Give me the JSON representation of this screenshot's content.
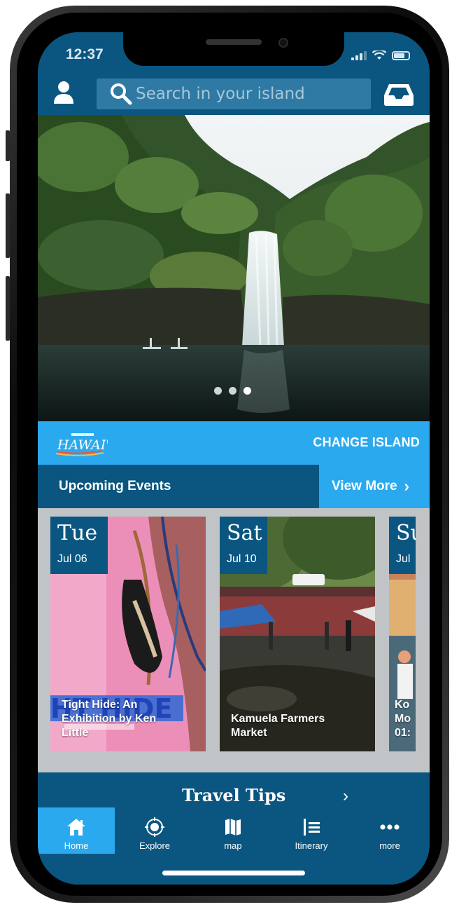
{
  "status": {
    "time": "12:37"
  },
  "header": {
    "search_placeholder": "Search in your island"
  },
  "hero": {
    "carousel_pages": 3,
    "active_page": 3
  },
  "island": {
    "logo_text": "HAWAI'I",
    "change_label": "CHANGE ISLAND"
  },
  "events": {
    "title": "Upcoming Events",
    "view_more": "View More",
    "items": [
      {
        "day": "Tue",
        "date": "Jul 06",
        "title": "Tight Hide: An Exhibition by Ken Little",
        "artwork_text": "HT HIDE"
      },
      {
        "day": "Sat",
        "date": "Jul 10",
        "title": "Kamuela Farmers Market"
      },
      {
        "day": "Su",
        "date": "Jul",
        "title": "Ko Mo 01:"
      }
    ]
  },
  "travel_tips": {
    "title": "Travel Tips"
  },
  "tabs": [
    {
      "label": "Home",
      "icon": "home-icon",
      "active": true
    },
    {
      "label": "Explore",
      "icon": "explore-icon",
      "active": false
    },
    {
      "label": "map",
      "icon": "map-icon",
      "active": false
    },
    {
      "label": "Itinerary",
      "icon": "itinerary-icon",
      "active": false
    },
    {
      "label": "more",
      "icon": "more-icon",
      "active": false
    }
  ],
  "colors": {
    "primary": "#0b5680",
    "accent": "#2ba9ee",
    "strip": "#c1c4c7"
  }
}
